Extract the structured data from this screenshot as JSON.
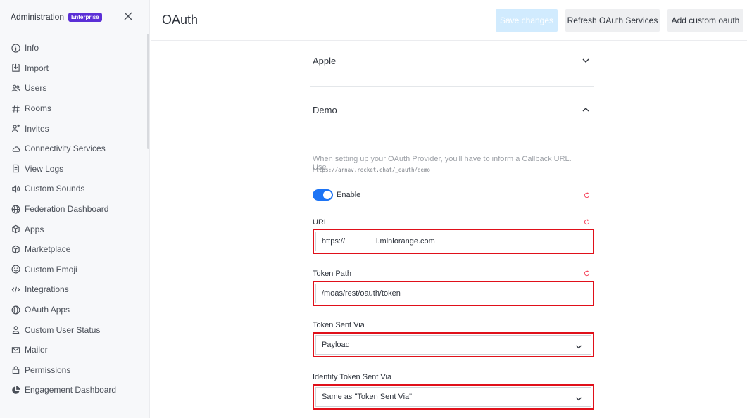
{
  "sidebar": {
    "title": "Administration",
    "badge": "Enterprise",
    "items": [
      {
        "label": "Info",
        "icon": "info-icon"
      },
      {
        "label": "Import",
        "icon": "import-icon"
      },
      {
        "label": "Users",
        "icon": "users-icon"
      },
      {
        "label": "Rooms",
        "icon": "hashtag-icon"
      },
      {
        "label": "Invites",
        "icon": "user-plus-icon"
      },
      {
        "label": "Connectivity Services",
        "icon": "cloud-icon"
      },
      {
        "label": "View Logs",
        "icon": "document-icon"
      },
      {
        "label": "Custom Sounds",
        "icon": "sound-icon"
      },
      {
        "label": "Federation Dashboard",
        "icon": "globe-icon"
      },
      {
        "label": "Apps",
        "icon": "cube-icon"
      },
      {
        "label": "Marketplace",
        "icon": "cube-icon"
      },
      {
        "label": "Custom Emoji",
        "icon": "emoji-icon"
      },
      {
        "label": "Integrations",
        "icon": "code-icon"
      },
      {
        "label": "OAuth Apps",
        "icon": "globe-icon"
      },
      {
        "label": "Custom User Status",
        "icon": "user-icon"
      },
      {
        "label": "Mailer",
        "icon": "mail-icon"
      },
      {
        "label": "Permissions",
        "icon": "lock-icon"
      },
      {
        "label": "Engagement Dashboard",
        "icon": "pie-chart-icon"
      }
    ]
  },
  "header": {
    "title": "OAuth",
    "save_label": "Save changes",
    "refresh_label": "Refresh OAuth Services",
    "add_label": "Add custom oauth"
  },
  "sections": {
    "apple": "Apple",
    "demo": "Demo"
  },
  "demo": {
    "hint": "When setting up your OAuth Provider, you'll have to inform a Callback URL. Use",
    "callback_url": "https://arnav.rocket.chat/_oauth/demo",
    "hint_end": ".",
    "enable_label": "Enable",
    "enabled": true,
    "url_label": "URL",
    "url_prefix": "https://",
    "url_suffix": "i.miniorange.com",
    "token_path_label": "Token Path",
    "token_path_value": "/moas/rest/oauth/token",
    "token_sent_via_label": "Token Sent Via",
    "token_sent_via_value": "Payload",
    "identity_token_label": "Identity Token Sent Via",
    "identity_token_value": "Same as \"Token Sent Via\""
  },
  "colors": {
    "accent": "#1d74f5",
    "highlight": "#e0101a",
    "badge": "#5b2fd6",
    "save_disabled": "#d1ebfe"
  }
}
